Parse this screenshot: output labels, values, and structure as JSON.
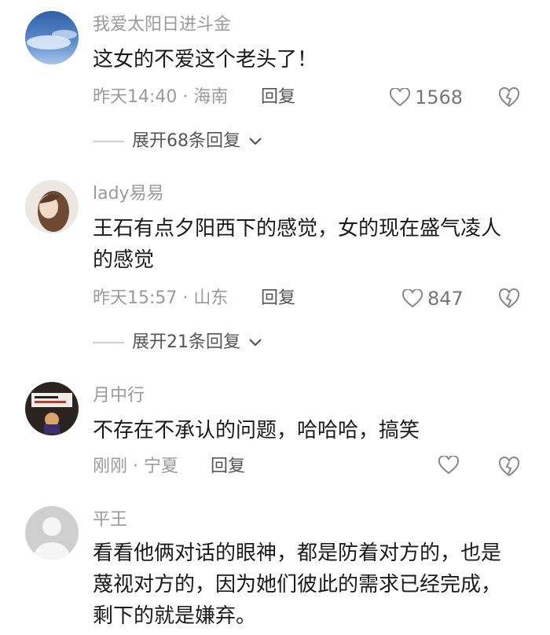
{
  "comments": [
    {
      "username": "我爱太阳日进斗金",
      "text": "这女的不爱这个老头了！",
      "meta": "昨天14:40 · 海南",
      "reply_label": "回复",
      "likes": "1568",
      "expand_label": "展开68条回复"
    },
    {
      "username": "lady易易",
      "text": "王石有点夕阳西下的感觉，女的现在盛气凌人的感觉",
      "meta": "昨天15:57 · 山东",
      "reply_label": "回复",
      "likes": "847",
      "expand_label": "展开21条回复"
    },
    {
      "username": "月中行",
      "text": "不存在不承认的问题，哈哈哈，搞笑",
      "meta": "刚刚 · 宁夏",
      "reply_label": "回复",
      "likes": ""
    },
    {
      "username": "平王",
      "text": "看看他俩对话的眼神，都是防着对方的，也是蔑视对方的，因为她们彼此的需求已经完成，剩下的就是嫌弃。"
    }
  ],
  "icons": {
    "like": "heart-outline-icon",
    "dislike": "broken-heart-icon",
    "expand": "chevron-down-icon"
  },
  "colors": {
    "secondary_text": "#9a9a9a",
    "primary_text": "#1a1a1a"
  }
}
